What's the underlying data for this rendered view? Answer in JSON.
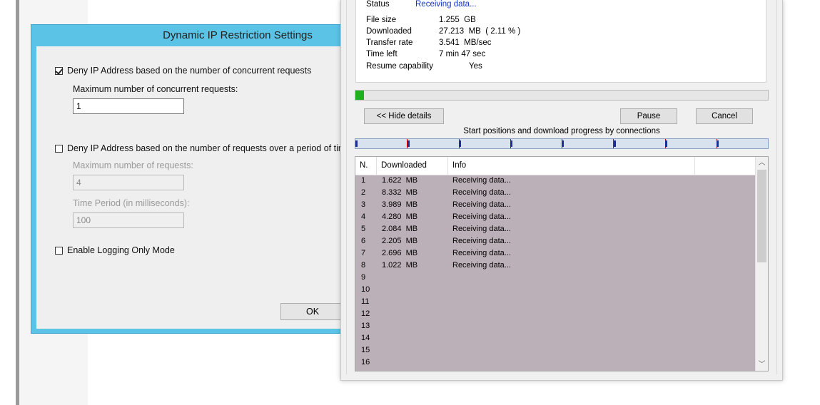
{
  "ip_dialog": {
    "title": "Dynamic IP Restriction Settings",
    "concurrent": {
      "checked": true,
      "label": "Deny IP Address based on the number of concurrent requests",
      "max_label": "Maximum number of concurrent requests:",
      "max_value": "1"
    },
    "period": {
      "checked": false,
      "label": "Deny IP Address based on the number of requests over a period of time",
      "max_label": "Maximum number of requests:",
      "max_value": "4",
      "time_label": "Time Period (in milliseconds):",
      "time_value": "100"
    },
    "logging": {
      "checked": false,
      "label": "Enable Logging Only Mode"
    },
    "ok_label": "OK"
  },
  "download": {
    "status_key": "Status",
    "status_value": "Receiving data...",
    "file_size_key": "File size",
    "file_size_value": "1.255  GB",
    "downloaded_key": "Downloaded",
    "downloaded_value": "27.213  MB  ( 2.11 % )",
    "transfer_key": "Transfer rate",
    "transfer_value": "3.541  MB/sec",
    "time_left_key": "Time left",
    "time_left_value": "7 min 47 sec",
    "resume_key": "Resume capability",
    "resume_value": "Yes",
    "progress_percent": 2.11,
    "hide_details_label": "<< Hide details",
    "pause_label": "Pause",
    "cancel_label": "Cancel",
    "connections_caption": "Start positions and download progress by connections",
    "connection_segments": 8,
    "table": {
      "headers": [
        "N.",
        "Downloaded",
        "Info"
      ],
      "rows": [
        {
          "n": "1",
          "downloaded": "1.622  MB",
          "info": "Receiving data..."
        },
        {
          "n": "2",
          "downloaded": "8.332  MB",
          "info": "Receiving data..."
        },
        {
          "n": "3",
          "downloaded": "3.989  MB",
          "info": "Receiving data..."
        },
        {
          "n": "4",
          "downloaded": "4.280  MB",
          "info": "Receiving data..."
        },
        {
          "n": "5",
          "downloaded": "2.084  MB",
          "info": "Receiving data..."
        },
        {
          "n": "6",
          "downloaded": "2.205  MB",
          "info": "Receiving data..."
        },
        {
          "n": "7",
          "downloaded": "2.696  MB",
          "info": "Receiving data..."
        },
        {
          "n": "8",
          "downloaded": "1.022  MB",
          "info": "Receiving data..."
        },
        {
          "n": "9",
          "downloaded": "",
          "info": ""
        },
        {
          "n": "10",
          "downloaded": "",
          "info": ""
        },
        {
          "n": "11",
          "downloaded": "",
          "info": ""
        },
        {
          "n": "12",
          "downloaded": "",
          "info": ""
        },
        {
          "n": "13",
          "downloaded": "",
          "info": ""
        },
        {
          "n": "14",
          "downloaded": "",
          "info": ""
        },
        {
          "n": "15",
          "downloaded": "",
          "info": ""
        },
        {
          "n": "16",
          "downloaded": "",
          "info": ""
        }
      ]
    },
    "colors": {
      "progress": "#1fb020",
      "rows_bg": "#bcb0b8",
      "status_link": "#1133cc"
    }
  }
}
